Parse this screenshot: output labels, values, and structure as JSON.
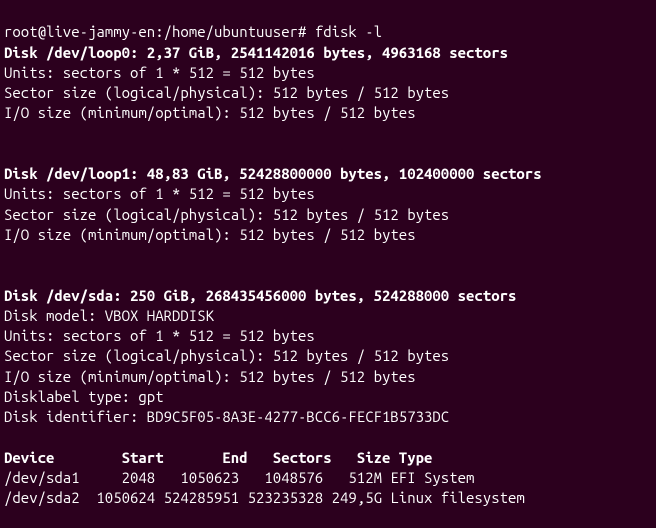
{
  "prompt": {
    "user_host": "root@live-jammy-en",
    "cwd": "/home/ubuntuuser",
    "sep": ":",
    "sigil": "#",
    "command": "fdisk -l"
  },
  "disks": [
    {
      "header": "Disk /dev/loop0: 2,37 GiB, 2541142016 bytes, 4963168 sectors",
      "lines": [
        "Units: sectors of 1 * 512 = 512 bytes",
        "Sector size (logical/physical): 512 bytes / 512 bytes",
        "I/O size (minimum/optimal): 512 bytes / 512 bytes"
      ]
    },
    {
      "header": "Disk /dev/loop1: 48,83 GiB, 52428800000 bytes, 102400000 sectors",
      "lines": [
        "Units: sectors of 1 * 512 = 512 bytes",
        "Sector size (logical/physical): 512 bytes / 512 bytes",
        "I/O size (minimum/optimal): 512 bytes / 512 bytes"
      ]
    },
    {
      "header": "Disk /dev/sda: 250 GiB, 268435456000 bytes, 524288000 sectors",
      "lines": [
        "Disk model: VBOX HARDDISK",
        "Units: sectors of 1 * 512 = 512 bytes",
        "Sector size (logical/physical): 512 bytes / 512 bytes",
        "I/O size (minimum/optimal): 512 bytes / 512 bytes",
        "Disklabel type: gpt",
        "Disk identifier: BD9C5F05-8A3E-4277-BCC6-FECF1B5733DC"
      ]
    }
  ],
  "partition_table": {
    "header": "Device        Start       End   Sectors   Size Type",
    "rows": [
      "/dev/sda1     2048   1050623   1048576   512M EFI System",
      "/dev/sda2  1050624 524285951 523235328 249,5G Linux filesystem"
    ]
  },
  "chart_data": {
    "type": "table",
    "title": "fdisk -l partition table for /dev/sda",
    "columns": [
      "Device",
      "Start",
      "End",
      "Sectors",
      "Size",
      "Type"
    ],
    "rows": [
      [
        "/dev/sda1",
        2048,
        1050623,
        1048576,
        "512M",
        "EFI System"
      ],
      [
        "/dev/sda2",
        1050624,
        524285951,
        523235328,
        "249,5G",
        "Linux filesystem"
      ]
    ]
  }
}
